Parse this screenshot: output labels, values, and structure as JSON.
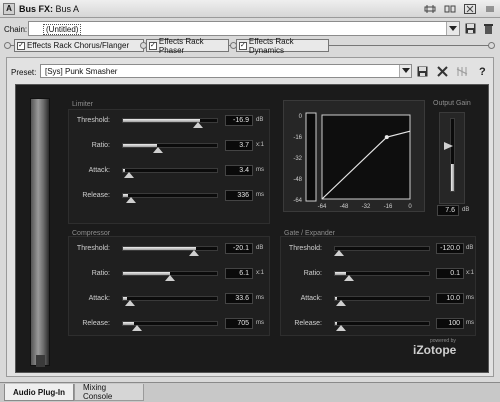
{
  "titlebar": {
    "icon_letter": "A",
    "title": "Bus FX:",
    "subtitle": "Bus A"
  },
  "chain": {
    "label": "Chain:",
    "value": "(Untitled)"
  },
  "effects": [
    {
      "label": "Effects Rack Chorus/Flanger",
      "checked": true
    },
    {
      "label": "Effects Rack Phaser",
      "checked": true
    },
    {
      "label": "Effects Rack Dynamics",
      "checked": true
    }
  ],
  "preset": {
    "label": "Preset:",
    "value": "[Sys] Punk Smasher"
  },
  "limiter": {
    "title": "Limiter",
    "params": [
      {
        "label": "Threshold:",
        "value": "-16.9",
        "unit": "dB",
        "level": 0.82
      },
      {
        "label": "Ratio:",
        "value": "3.7",
        "unit": "x:1",
        "level": 0.36
      },
      {
        "label": "Attack:",
        "value": "3.4",
        "unit": "ms",
        "level": 0.02
      },
      {
        "label": "Release:",
        "value": "336",
        "unit": "ms",
        "level": 0.05
      }
    ]
  },
  "compressor": {
    "title": "Compressor",
    "params": [
      {
        "label": "Threshold:",
        "value": "-20.1",
        "unit": "dB",
        "level": 0.78
      },
      {
        "label": "Ratio:",
        "value": "6.1",
        "unit": "x:1",
        "level": 0.5
      },
      {
        "label": "Attack:",
        "value": "33.6",
        "unit": "ms",
        "level": 0.04
      },
      {
        "label": "Release:",
        "value": "705",
        "unit": "ms",
        "level": 0.12
      }
    ]
  },
  "gate": {
    "title": "Gate / Expander",
    "params": [
      {
        "label": "Threshold:",
        "value": "-120.0",
        "unit": "dB",
        "level": 0.0
      },
      {
        "label": "Ratio:",
        "value": "0.1",
        "unit": "x:1",
        "level": 0.12
      },
      {
        "label": "Attack:",
        "value": "10.0",
        "unit": "ms",
        "level": 0.02
      },
      {
        "label": "Release:",
        "value": "100",
        "unit": "ms",
        "level": 0.02
      }
    ]
  },
  "graph": {
    "y_ticks": [
      "0",
      "-16",
      "-32",
      "-48",
      "-64"
    ],
    "x_ticks": [
      "-64",
      "-48",
      "-32",
      "-16",
      "0"
    ],
    "curve_points": [
      [
        -64,
        -64
      ],
      [
        -16.9,
        -16.9
      ],
      [
        0,
        -12.3
      ]
    ]
  },
  "output_gain": {
    "title": "Output Gain",
    "value": "7.6",
    "unit": "dB",
    "level": 0.62
  },
  "brand": {
    "powered_by": "powered by",
    "name": "iZotope"
  },
  "tabs": [
    {
      "label": "Audio Plug-In",
      "active": true
    },
    {
      "label": "Mixing Console",
      "active": false
    }
  ],
  "colors": {
    "panel": "#1b1b1b",
    "section_bg": "#1f1f1f",
    "fill": "#f0f0f0"
  },
  "icons": [
    "pin-icon",
    "restore-icon",
    "close-icon",
    "save-icon",
    "delete-icon",
    "power-icon",
    "help-icon"
  ]
}
